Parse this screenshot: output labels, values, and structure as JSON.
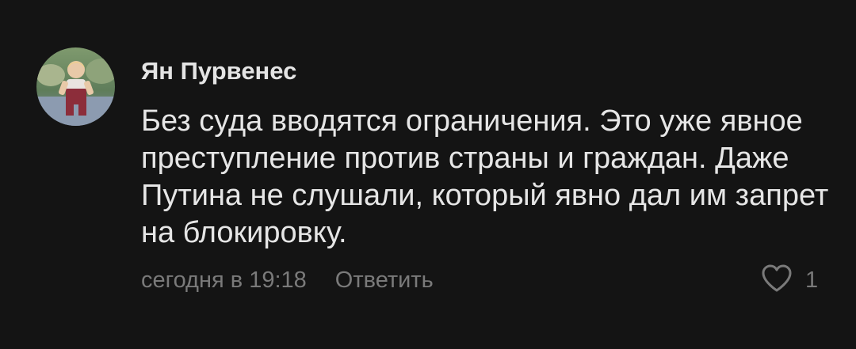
{
  "comment": {
    "author": "Ян Пурвенес",
    "text": "Без суда вводятся ограничения. Это уже явное преступление против страны и граждан. Даже Путина не слушали, который явно дал им запрет на блокировку.",
    "timestamp": "сегодня в 19:18",
    "reply_label": "Ответить",
    "like_icon": "heart-outline-icon",
    "like_count": "1"
  },
  "colors": {
    "background": "#141414",
    "author": "#e4e4e4",
    "text": "#e6e6e6",
    "meta": "#7a7a7a"
  }
}
